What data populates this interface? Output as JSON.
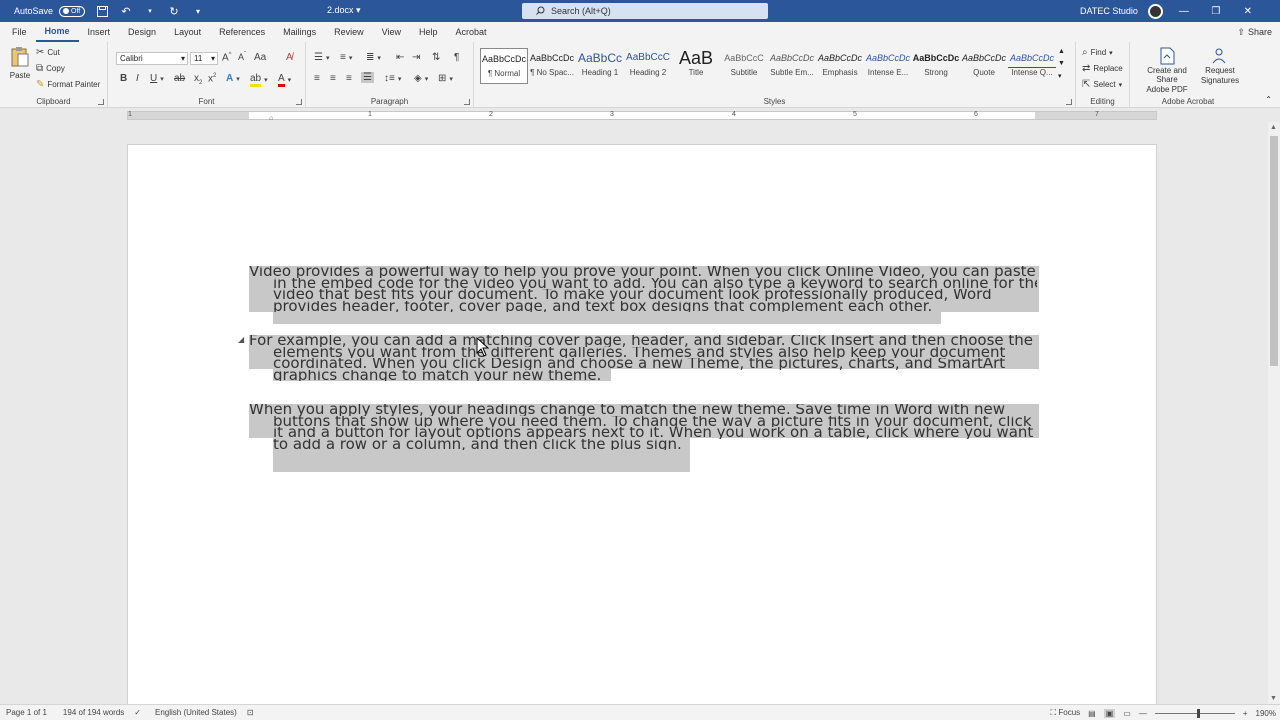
{
  "titlebar": {
    "autosave_label": "AutoSave",
    "autosave_state": "Off",
    "doc_title": "2.docx",
    "search_placeholder": "Search (Alt+Q)",
    "user_name": "DATEC Studio"
  },
  "tabs": [
    "File",
    "Home",
    "Insert",
    "Design",
    "Layout",
    "References",
    "Mailings",
    "Review",
    "View",
    "Help",
    "Acrobat"
  ],
  "share_label": "Share",
  "ribbon": {
    "clipboard": {
      "paste_label": "Paste",
      "cut_label": "Cut",
      "copy_label": "Copy",
      "format_painter_label": "Format Painter",
      "group_label": "Clipboard"
    },
    "font": {
      "font_name": "Calibri",
      "font_size": "11",
      "group_label": "Font"
    },
    "paragraph": {
      "group_label": "Paragraph"
    },
    "styles": {
      "group_label": "Styles",
      "items": [
        {
          "sample": "AaBbCcDc",
          "name": "¶ Normal"
        },
        {
          "sample": "AaBbCcDc",
          "name": "¶ No Spac..."
        },
        {
          "sample": "AaBbCc",
          "name": "Heading 1"
        },
        {
          "sample": "AaBbCcC",
          "name": "Heading 2"
        },
        {
          "sample": "AaB",
          "name": "Title"
        },
        {
          "sample": "AaBbCcC",
          "name": "Subtitle"
        },
        {
          "sample": "AaBbCcDc",
          "name": "Subtle Em..."
        },
        {
          "sample": "AaBbCcDc",
          "name": "Emphasis"
        },
        {
          "sample": "AaBbCcDc",
          "name": "Intense E..."
        },
        {
          "sample": "AaBbCcDc",
          "name": "Strong"
        },
        {
          "sample": "AaBbCcDc",
          "name": "Quote"
        },
        {
          "sample": "AaBbCcDc",
          "name": "Intense Q..."
        }
      ]
    },
    "editing": {
      "find_label": "Find",
      "replace_label": "Replace",
      "select_label": "Select",
      "group_label": "Editing"
    },
    "acrobat": {
      "create_share_line1": "Create and Share",
      "create_share_line2": "Adobe PDF",
      "request_sig_line1": "Request",
      "request_sig_line2": "Signatures",
      "group_label": "Adobe Acrobat"
    }
  },
  "ruler_numbers": [
    "1",
    "1",
    "2",
    "3",
    "4",
    "5",
    "6",
    "7"
  ],
  "document": {
    "paragraphs": [
      {
        "lines": [
          "Video provides a powerful way to help you prove your point. When you click Online Video, you can paste",
          "in the embed code for the video you want to add. You can also type a keyword to search online for the",
          "video that best fits your document. To make your document look professionally produced, Word",
          "provides header, footer, cover page, and text box designs that complement each other."
        ]
      },
      {
        "lines": [
          "For example, you can add a matching cover page, header, and sidebar. Click Insert and then choose the",
          "elements you want from the different galleries. Themes and styles also help keep your document",
          "coordinated. When you click Design and choose a new Theme, the pictures, charts, and SmartArt",
          "graphics change to match your new theme."
        ]
      },
      {
        "lines": [
          "When you apply styles, your headings change to match the new theme. Save time in Word with new",
          "buttons that show up where you need them. To change the way a picture fits in your document, click",
          "it and a button for layout options appears next to it. When you work on a table, click where you want",
          "to add a row or a column, and then click the plus sign."
        ]
      }
    ]
  },
  "statusbar": {
    "page": "Page 1 of 1",
    "words": "194 of 194 words",
    "language": "English (United States)",
    "focus_label": "Focus",
    "zoom": "190%"
  },
  "colors": {
    "titlebar_bg": "#2b579a",
    "selection": "#c8c8c8"
  }
}
